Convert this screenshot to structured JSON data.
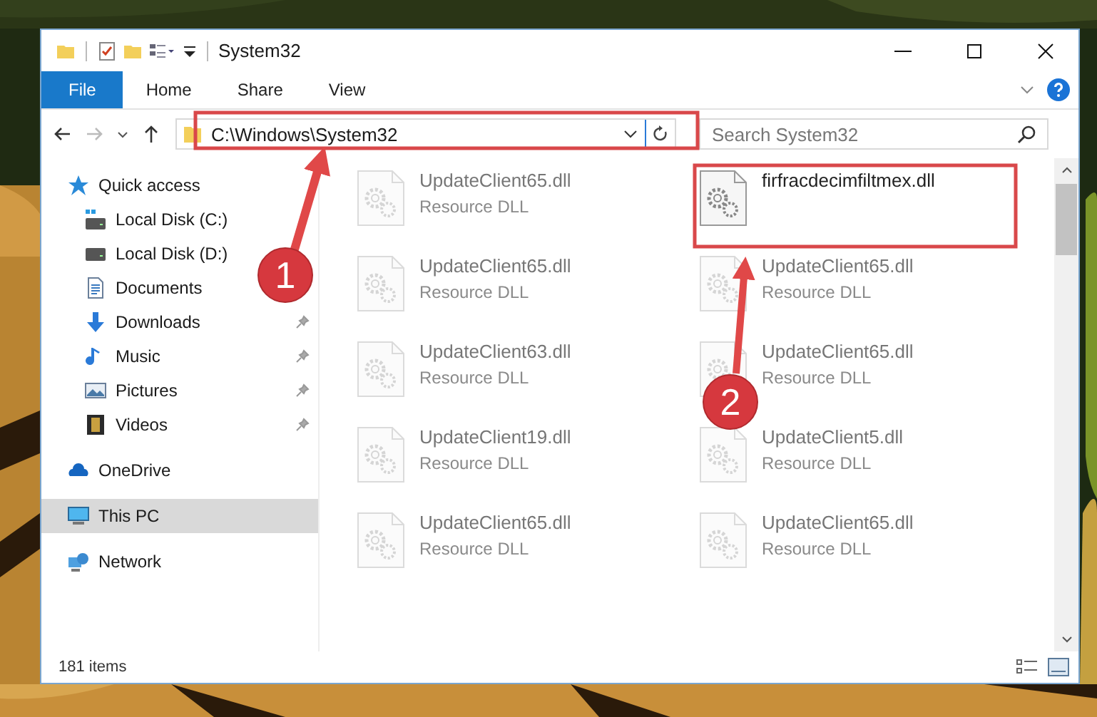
{
  "window": {
    "title": "System32"
  },
  "ribbon": {
    "tabs": [
      {
        "label": "File",
        "selected": true
      },
      {
        "label": "Home",
        "selected": false
      },
      {
        "label": "Share",
        "selected": false
      },
      {
        "label": "View",
        "selected": false
      }
    ]
  },
  "address": {
    "path": "C:\\Windows\\System32"
  },
  "search": {
    "placeholder": "Search System32"
  },
  "sidebar": {
    "items": [
      {
        "label": "Quick access",
        "kind": "quick",
        "selected": false,
        "children": [
          {
            "label": "Local Disk (C:)",
            "kind": "drive-c",
            "pinned": false
          },
          {
            "label": "Local Disk (D:)",
            "kind": "drive",
            "pinned": false
          },
          {
            "label": "Documents",
            "kind": "document",
            "pinned": false
          },
          {
            "label": "Downloads",
            "kind": "download",
            "pinned": true
          },
          {
            "label": "Music",
            "kind": "music",
            "pinned": true
          },
          {
            "label": "Pictures",
            "kind": "picture",
            "pinned": true
          },
          {
            "label": "Videos",
            "kind": "video",
            "pinned": true
          }
        ]
      },
      {
        "label": "OneDrive",
        "kind": "cloud",
        "selected": false
      },
      {
        "label": "This PC",
        "kind": "computer",
        "selected": true
      },
      {
        "label": "Network",
        "kind": "network",
        "selected": false
      }
    ]
  },
  "files": {
    "items": [
      {
        "name": "UpdateClient65.dll",
        "type": "Resource DLL",
        "blurred": true
      },
      {
        "name": "UpdateClient65.dll",
        "type": "Resource DLL",
        "blurred": true
      },
      {
        "name": "UpdateClient63.dll",
        "type": "Resource DLL",
        "blurred": true
      },
      {
        "name": "UpdateClient19.dll",
        "type": "Resource DLL",
        "blurred": true
      },
      {
        "name": "UpdateClient65.dll",
        "type": "Resource DLL",
        "blurred": true
      },
      {
        "name": "firfracdecimfiltmex.dll",
        "blurred": false
      },
      {
        "name": "UpdateClient65.dll",
        "type": "Resource DLL",
        "blurred": true
      },
      {
        "name": "UpdateClient65.dll",
        "type": "Resource DLL",
        "blurred": true
      },
      {
        "name": "UpdateClient5.dll",
        "type": "Resource DLL",
        "blurred": true
      },
      {
        "name": "UpdateClient65.dll",
        "type": "Resource DLL",
        "blurred": true
      }
    ]
  },
  "status_bar": {
    "count": "181 items"
  },
  "annotations": [
    {
      "number": "1"
    },
    {
      "number": "2"
    }
  ]
}
